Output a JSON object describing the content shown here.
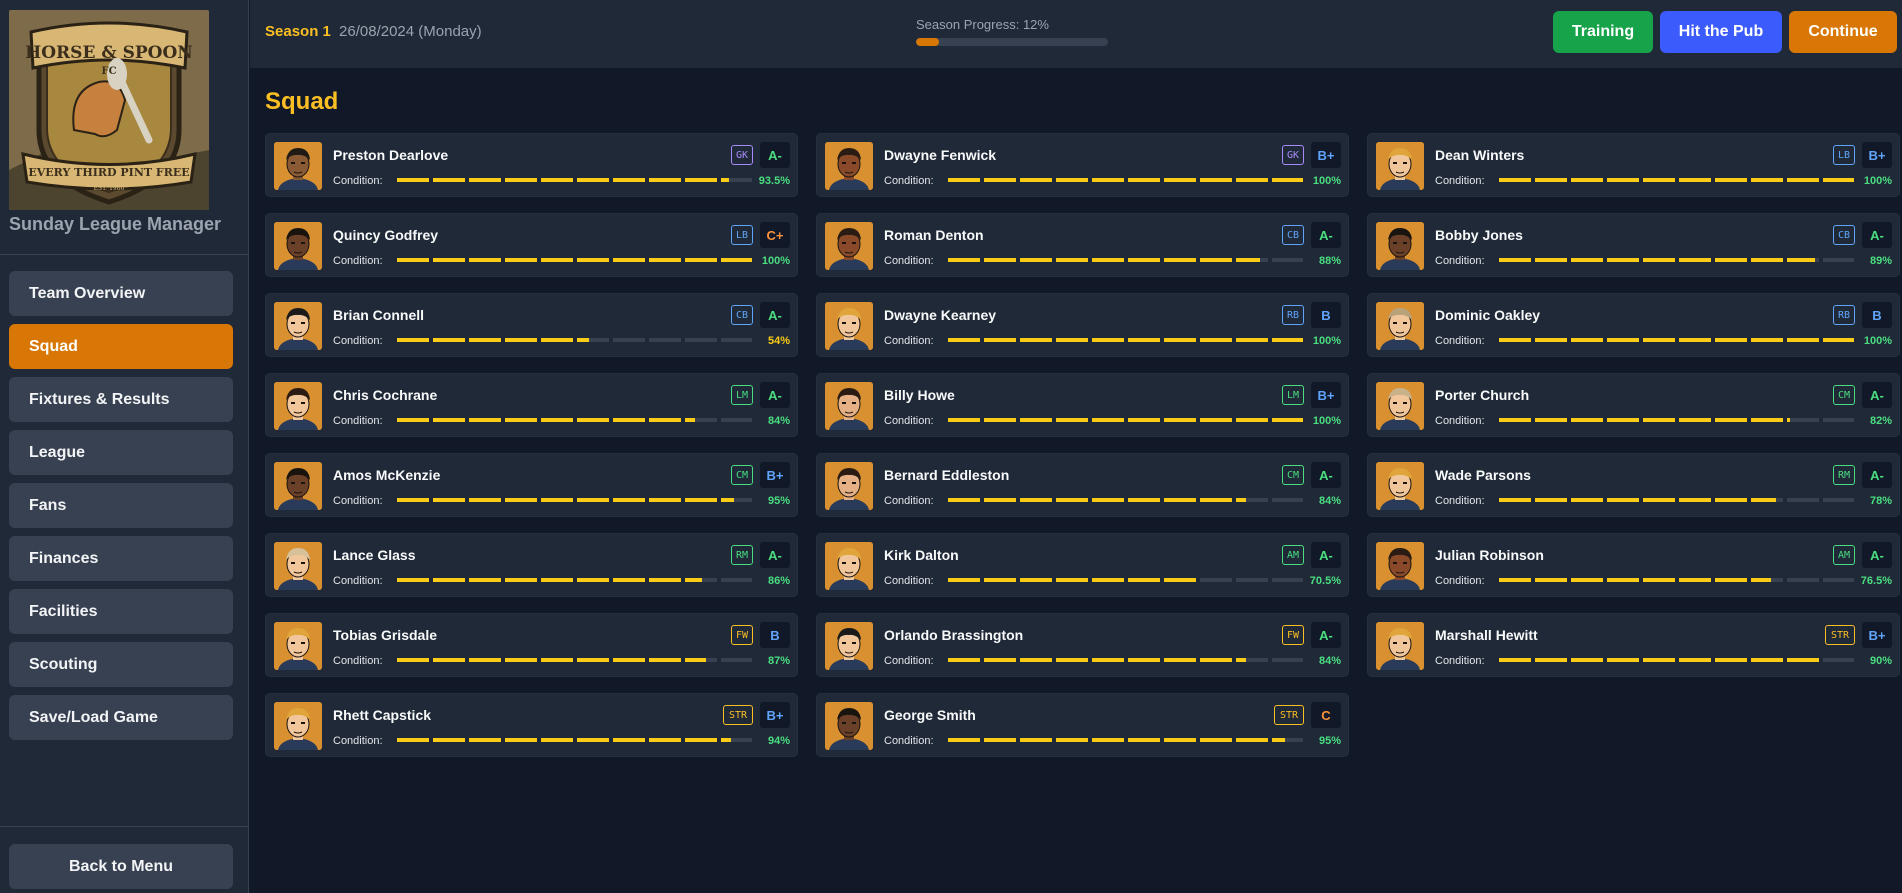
{
  "app": {
    "title": "Sunday League Manager",
    "logo_alt": "Horse & Spoon FC crest"
  },
  "logo": {
    "line1": "HORSE & SPOON",
    "line2": "FC",
    "motto": "EVERY THIRD PINT FREE",
    "est": "EST. 1986"
  },
  "sidebar": {
    "items": [
      {
        "label": "Team Overview",
        "active": false
      },
      {
        "label": "Squad",
        "active": true
      },
      {
        "label": "Fixtures & Results",
        "active": false
      },
      {
        "label": "League",
        "active": false
      },
      {
        "label": "Fans",
        "active": false
      },
      {
        "label": "Finances",
        "active": false
      },
      {
        "label": "Facilities",
        "active": false
      },
      {
        "label": "Scouting",
        "active": false
      },
      {
        "label": "Save/Load Game",
        "active": false
      }
    ],
    "back_label": "Back to Menu"
  },
  "header": {
    "season": "Season 1",
    "date": "26/08/2024 (Monday)",
    "progress_label": "Season Progress: 12%",
    "progress_value": 12,
    "buttons": {
      "training": "Training",
      "pub": "Hit the Pub",
      "continue": "Continue"
    }
  },
  "page_title": "Squad",
  "colors": {
    "accent": "#d97706",
    "gold": "#fbbf24",
    "green": "#4ade80",
    "blue": "#60a5fa",
    "purple": "#a78bfa",
    "yellow": "#facc15",
    "orange": "#fb923c"
  },
  "condition_label": "Condition:",
  "players": [
    {
      "name": "Preston Dearlove",
      "pos": "GK",
      "rating": "A-",
      "condition": "93.5%",
      "cond_value": 93.5,
      "skin": "#8a5a34",
      "hair": "#1f1a14"
    },
    {
      "name": "Dwayne Fenwick",
      "pos": "GK",
      "rating": "B+",
      "condition": "100%",
      "cond_value": 100,
      "skin": "#8a4a2a",
      "hair": "#2a1c12"
    },
    {
      "name": "Dean Winters",
      "pos": "LB",
      "rating": "B+",
      "condition": "100%",
      "cond_value": 100,
      "skin": "#f0c69a",
      "hair": "#e0a53a"
    },
    {
      "name": "Quincy Godfrey",
      "pos": "LB",
      "rating": "C+",
      "condition": "100%",
      "cond_value": 100,
      "skin": "#6b4028",
      "hair": "#1a140f"
    },
    {
      "name": "Roman Denton",
      "pos": "CB",
      "rating": "A-",
      "condition": "88%",
      "cond_value": 88,
      "skin": "#8a4a2a",
      "hair": "#2a1c12"
    },
    {
      "name": "Bobby Jones",
      "pos": "CB",
      "rating": "A-",
      "condition": "89%",
      "cond_value": 89,
      "skin": "#6b4028",
      "hair": "#1a140f"
    },
    {
      "name": "Brian Connell",
      "pos": "CB",
      "rating": "A-",
      "condition": "54%",
      "cond_value": 54,
      "skin": "#f0c69a",
      "hair": "#1a1a1a"
    },
    {
      "name": "Dwayne Kearney",
      "pos": "RB",
      "rating": "B",
      "condition": "100%",
      "cond_value": 100,
      "skin": "#f0c69a",
      "hair": "#e0a53a"
    },
    {
      "name": "Dominic Oakley",
      "pos": "RB",
      "rating": "B",
      "condition": "100%",
      "cond_value": 100,
      "skin": "#f0c69a",
      "hair": "#b9a27a"
    },
    {
      "name": "Chris Cochrane",
      "pos": "LM",
      "rating": "A-",
      "condition": "84%",
      "cond_value": 84,
      "skin": "#f0c69a",
      "hair": "#2a1c12"
    },
    {
      "name": "Billy Howe",
      "pos": "LM",
      "rating": "B+",
      "condition": "100%",
      "cond_value": 100,
      "skin": "#e5b085",
      "hair": "#2a1c12"
    },
    {
      "name": "Porter Church",
      "pos": "CM",
      "rating": "A-",
      "condition": "82%",
      "cond_value": 82,
      "skin": "#f0c69a",
      "hair": "#c9b28a"
    },
    {
      "name": "Amos McKenzie",
      "pos": "CM",
      "rating": "B+",
      "condition": "95%",
      "cond_value": 95,
      "skin": "#6b4028",
      "hair": "#1a140f"
    },
    {
      "name": "Bernard Eddleston",
      "pos": "CM",
      "rating": "A-",
      "condition": "84%",
      "cond_value": 84,
      "skin": "#e5b085",
      "hair": "#2a1c12"
    },
    {
      "name": "Wade Parsons",
      "pos": "RM",
      "rating": "A-",
      "condition": "78%",
      "cond_value": 78,
      "skin": "#f0c69a",
      "hair": "#e0a53a"
    },
    {
      "name": "Lance Glass",
      "pos": "RM",
      "rating": "A-",
      "condition": "86%",
      "cond_value": 86,
      "skin": "#f0c69a",
      "hair": "#d6c29a"
    },
    {
      "name": "Kirk Dalton",
      "pos": "AM",
      "rating": "A-",
      "condition": "70.5%",
      "cond_value": 70.5,
      "skin": "#f0c69a",
      "hair": "#e0a53a"
    },
    {
      "name": "Julian Robinson",
      "pos": "AM",
      "rating": "A-",
      "condition": "76.5%",
      "cond_value": 76.5,
      "skin": "#8a4a2a",
      "hair": "#2a1c12"
    },
    {
      "name": "Tobias Grisdale",
      "pos": "FW",
      "rating": "B",
      "condition": "87%",
      "cond_value": 87,
      "skin": "#f0c69a",
      "hair": "#e0a53a"
    },
    {
      "name": "Orlando Brassington",
      "pos": "FW",
      "rating": "A-",
      "condition": "84%",
      "cond_value": 84,
      "skin": "#f0c69a",
      "hair": "#1a1a1a"
    },
    {
      "name": "Marshall Hewitt",
      "pos": "STR",
      "rating": "B+",
      "condition": "90%",
      "cond_value": 90,
      "skin": "#f0c69a",
      "hair": "#e0a53a"
    },
    {
      "name": "Rhett Capstick",
      "pos": "STR",
      "rating": "B+",
      "condition": "94%",
      "cond_value": 94,
      "skin": "#f0c69a",
      "hair": "#e0a53a"
    },
    {
      "name": "George Smith",
      "pos": "STR",
      "rating": "C",
      "condition": "95%",
      "cond_value": 95,
      "skin": "#6b4028",
      "hair": "#1a140f"
    }
  ]
}
